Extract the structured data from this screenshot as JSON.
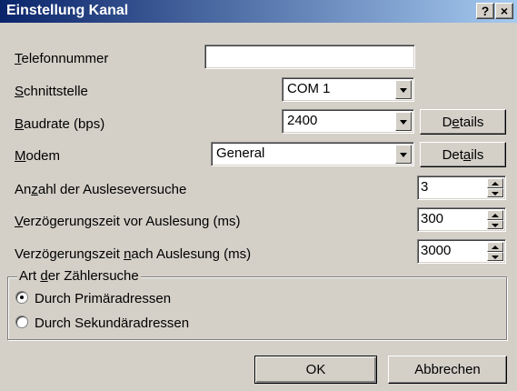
{
  "window": {
    "title": "Einstellung Kanal",
    "help_label": "?",
    "close_label": "×"
  },
  "telefon": {
    "label": "Telefonnummer",
    "value": ""
  },
  "schnittstelle": {
    "label": "Schnittstelle",
    "value": "COM 1"
  },
  "baudrate": {
    "label": "Baudrate (bps)",
    "value": "2400",
    "details_label": "Details"
  },
  "modem": {
    "label": "Modem",
    "value": "General",
    "details_label": "Details"
  },
  "ausleseversuche": {
    "label": "Anzahl der Ausleseversuche",
    "value": "3"
  },
  "verz_vor": {
    "label": "Verzögerungszeit vor Auslesung (ms)",
    "value": "300"
  },
  "verz_nach": {
    "label": "Verzögerungszeit nach Auslesung (ms)",
    "value": "3000"
  },
  "zaehlersuche": {
    "legend": "Art der Zählersuche",
    "options": [
      {
        "label": "Durch Primäradressen",
        "checked": true
      },
      {
        "label": "Durch Sekundäradressen",
        "checked": false
      }
    ]
  },
  "footer": {
    "ok_label": "OK",
    "cancel_label": "Abbrechen"
  },
  "colors": {
    "titlebar_start": "#0a246a",
    "titlebar_end": "#a6caf0",
    "face": "#d4d0c8"
  }
}
